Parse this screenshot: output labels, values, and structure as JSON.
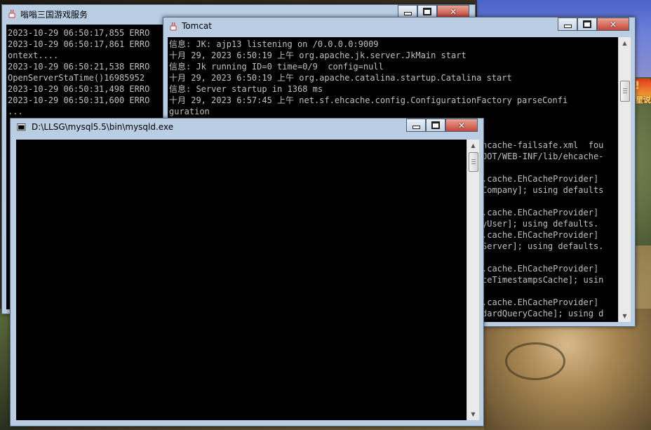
{
  "desktop": {
    "badge_text": "星说",
    "badge_mark": "!"
  },
  "windows": {
    "server": {
      "title": "嗡嗡三国游戏服务",
      "lines": [
        "2023-10-29 06:50:17,855 ERRO",
        "2023-10-29 06:50:17,861 ERRO",
        "ontext....",
        "2023-10-29 06:50:21,538 ERRO",
        "OpenServerStaTime()16985952",
        "2023-10-29 06:50:31,498 ERRO",
        "2023-10-29 06:50:31,600 ERRO",
        "..."
      ]
    },
    "tomcat": {
      "title": "Tomcat",
      "lines_top": [
        "信息: JK: ajp13 listening on /0.0.0.0:9009",
        "十月 29, 2023 6:50:19 上午 org.apache.jk.server.JkMain start",
        "信息: Jk running ID=0 time=0/9  config=null",
        "十月 29, 2023 6:50:19 上午 org.apache.catalina.startup.Catalina start",
        "信息: Server startup in 1368 ms",
        "十月 29, 2023 6:57:45 上午 net.sf.ehcache.config.ConfigurationFactory parseConfi",
        "guration"
      ],
      "lines_right": [
        "hcache-failsafe.xml  fou",
        "OOT/WEB-INF/lib/ehcache-",
        "",
        ".cache.EhCacheProvider]",
        "Company]; using defaults",
        "",
        ".cache.EhCacheProvider]",
        "yUser]; using defaults.",
        ".cache.EhCacheProvider]",
        "Server]; using defaults.",
        "",
        ".cache.EhCacheProvider]",
        "ceTimestampsCache]; usin",
        "",
        ".cache.EhCacheProvider]",
        "dardQueryCache]; using d"
      ]
    },
    "mysql": {
      "title": "D:\\LLSG\\mysql5.5\\bin\\mysqld.exe"
    }
  }
}
